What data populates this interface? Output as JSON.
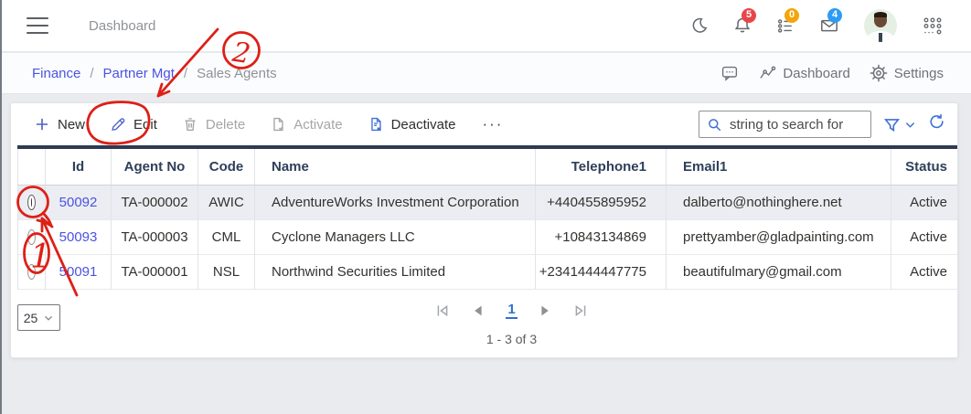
{
  "topbar": {
    "title": "Dashboard",
    "notifications_count": "5",
    "tasks_count": "0",
    "messages_count": "4"
  },
  "breadcrumb": {
    "separator": "/",
    "items": [
      "Finance",
      "Partner Mgt",
      "Sales Agents"
    ],
    "dashboard_label": "Dashboard",
    "settings_label": "Settings"
  },
  "toolbar": {
    "new_label": "New",
    "edit_label": "Edit",
    "delete_label": "Delete",
    "activate_label": "Activate",
    "deactivate_label": "Deactivate",
    "more_label": "···",
    "search_placeholder": "string to search for"
  },
  "table": {
    "columns": [
      "",
      "Id",
      "Agent No",
      "Code",
      "Name",
      "Telephone1",
      "Email1",
      "Status"
    ],
    "rows": [
      {
        "selected": true,
        "id": "50092",
        "agent_no": "TA-000002",
        "code": "AWIC",
        "name": "AdventureWorks Investment Corporation",
        "telephone1": "+440455895952",
        "email1": "dalberto@nothinghere.net",
        "status": "Active"
      },
      {
        "selected": false,
        "id": "50093",
        "agent_no": "TA-000003",
        "code": "CML",
        "name": "Cyclone Managers LLC",
        "telephone1": "+10843134869",
        "email1": "prettyamber@gladpainting.com",
        "status": "Active"
      },
      {
        "selected": false,
        "id": "50091",
        "agent_no": "TA-000001",
        "code": "NSL",
        "name": "Northwind Securities Limited",
        "telephone1": "+2341444447775",
        "email1": "beautifulmary@gmail.com",
        "status": "Active"
      }
    ]
  },
  "pagination": {
    "page_size": "25",
    "current_page": "1",
    "range_text": "1 - 3 of 3"
  },
  "annotations": {
    "step_1": "1",
    "step_2": "2"
  },
  "colors": {
    "link": "#4b53e0",
    "table_header_bar": "#2e3a52",
    "selected_row_bg": "#ebedf2",
    "annotation_red": "#dd2017",
    "notification_badge": "#e8454a",
    "tasks_badge": "#f3a60b",
    "messages_badge": "#2e9bf3",
    "toolbar_icon_blue": "#4d63c0",
    "action_icon_blue": "#3e6fd6",
    "page_link_blue": "#2f6fd0"
  }
}
